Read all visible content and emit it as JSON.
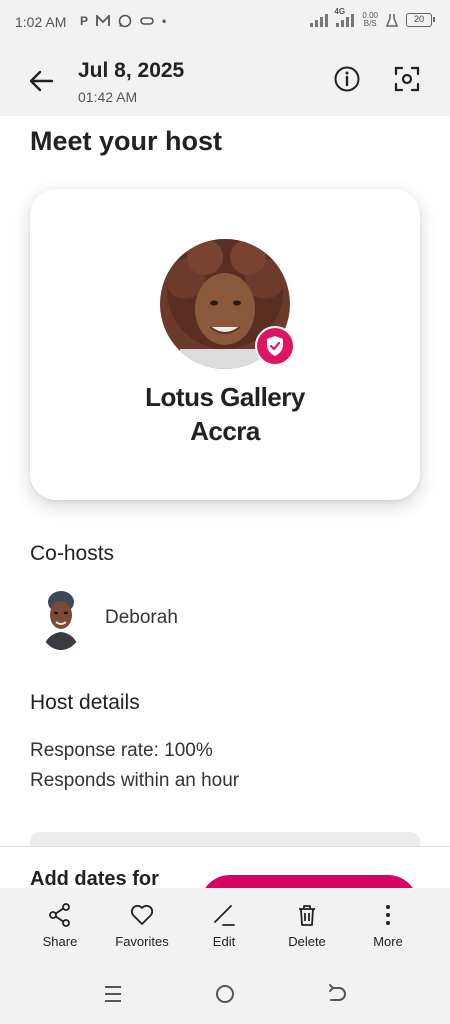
{
  "status_bar": {
    "time": "1:02 AM",
    "icons": [
      "P",
      "M",
      "whatsapp-icon",
      "game-icon",
      "•"
    ],
    "network": "4G",
    "speed_top": "0.00",
    "speed_bottom": "B/S",
    "battery": "20"
  },
  "header": {
    "date": "Jul 8, 2025",
    "time": "01:42 AM"
  },
  "main": {
    "title": "Meet your host",
    "host": {
      "name_line1": "Lotus Gallery",
      "name_line2": "Accra",
      "badge_color": "#e01561"
    },
    "cohosts": {
      "heading": "Co-hosts",
      "items": [
        {
          "name": "Deborah"
        }
      ]
    },
    "host_details": {
      "heading": "Host details",
      "response_rate": "Response rate: 100%",
      "response_time": "Responds within an hour"
    },
    "footer": {
      "add_dates": "Add dates for",
      "button_color": "#d70466"
    }
  },
  "actions": [
    {
      "label": "Share",
      "icon": "share-icon"
    },
    {
      "label": "Favorites",
      "icon": "heart-icon"
    },
    {
      "label": "Edit",
      "icon": "pencil-icon"
    },
    {
      "label": "Delete",
      "icon": "trash-icon"
    },
    {
      "label": "More",
      "icon": "more-vertical-icon"
    }
  ]
}
